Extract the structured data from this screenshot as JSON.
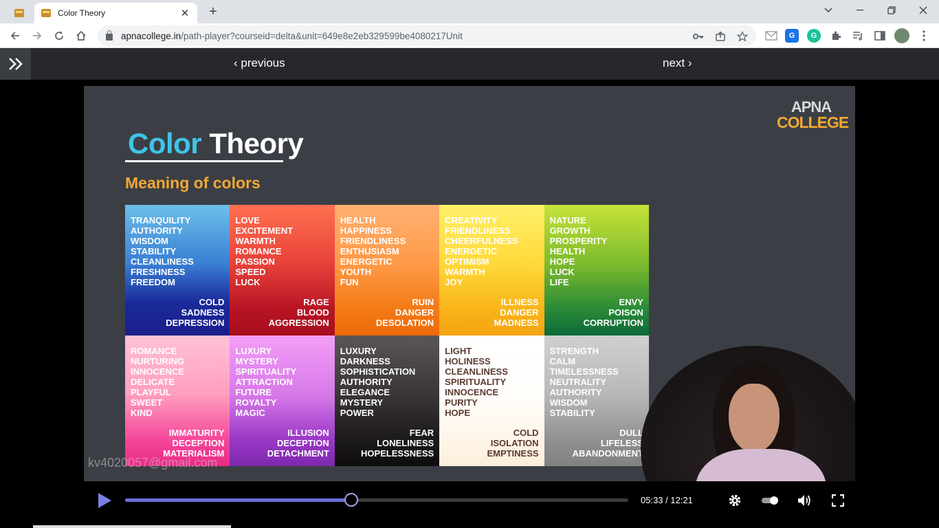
{
  "browser": {
    "tab_title": "Color Theory",
    "url_host": "apnacollege.in",
    "url_path": "/path-player?courseid=delta&unit=649e8e2eb329599be4080217Unit"
  },
  "player_nav": {
    "previous_label": "‹ previous",
    "next_label": "next ›"
  },
  "slide": {
    "title_part1": "Color",
    "title_part2": "Theory",
    "subtitle": "Meaning of colors",
    "logo_line1": "APNA",
    "logo_line2": "COLLEGE",
    "watermark": "kv4020057@gmail.com",
    "colors": [
      {
        "name": "blue",
        "positive": [
          "TRANQUILITY",
          "AUTHORITY",
          "WISDOM",
          "STABILITY",
          "CLEANLINESS",
          "FRESHNESS",
          "FREEDOM"
        ],
        "negative": [
          "COLD",
          "SADNESS",
          "DEPRESSION"
        ]
      },
      {
        "name": "red",
        "positive": [
          "LOVE",
          "EXCITEMENT",
          "WARMTH",
          "ROMANCE",
          "PASSION",
          "SPEED",
          "LUCK"
        ],
        "negative": [
          "RAGE",
          "BLOOD",
          "AGGRESSION"
        ]
      },
      {
        "name": "orange",
        "positive": [
          "HEALTH",
          "HAPPINESS",
          "FRIENDLINESS",
          "ENTHUSIASM",
          "ENERGETIC",
          "YOUTH",
          "FUN"
        ],
        "negative": [
          "RUIN",
          "DANGER",
          "DESOLATION"
        ]
      },
      {
        "name": "yellow",
        "positive": [
          "CREATIVITY",
          "FRIENDLINESS",
          "CHEERFULNESS",
          "ENERGETIC",
          "OPTIMISM",
          "WARMTH",
          "JOY"
        ],
        "negative": [
          "ILLNESS",
          "DANGER",
          "MADNESS"
        ]
      },
      {
        "name": "green",
        "positive": [
          "NATURE",
          "GROWTH",
          "PROSPERITY",
          "HEALTH",
          "HOPE",
          "LUCK",
          "LIFE"
        ],
        "negative": [
          "ENVY",
          "POISON",
          "CORRUPTION"
        ]
      },
      {
        "name": "pink",
        "positive": [
          "ROMANCE",
          "NURTURING",
          "INNOCENCE",
          "DELICATE",
          "PLAYFUL",
          "SWEET",
          "KIND"
        ],
        "negative": [
          "IMMATURITY",
          "DECEPTION",
          "MATERIALISM"
        ]
      },
      {
        "name": "purple",
        "positive": [
          "LUXURY",
          "MYSTERY",
          "SPIRITUALITY",
          "ATTRACTION",
          "FUTURE",
          "ROYALTY",
          "MAGIC"
        ],
        "negative": [
          "ILLUSION",
          "DECEPTION",
          "DETACHMENT"
        ]
      },
      {
        "name": "black",
        "positive": [
          "LUXURY",
          "DARKNESS",
          "SOPHISTICATION",
          "AUTHORITY",
          "ELEGANCE",
          "MYSTERY",
          "POWER"
        ],
        "negative": [
          "FEAR",
          "LONELINESS",
          "HOPELESSNESS"
        ]
      },
      {
        "name": "white",
        "positive": [
          "LIGHT",
          "HOLINESS",
          "CLEANLINESS",
          "SPIRITUALITY",
          "INNOCENCE",
          "PURITY",
          "HOPE"
        ],
        "negative": [
          "COLD",
          "ISOLATION",
          "EMPTINESS"
        ]
      },
      {
        "name": "gray",
        "positive": [
          "STRENGTH",
          "CALM",
          "TIMELESSNESS",
          "NEUTRALITY",
          "AUTHORITY",
          "WISDOM",
          "STABILITY"
        ],
        "negative": [
          "DULL",
          "LIFELESS",
          "ABANDONMENT"
        ]
      }
    ]
  },
  "controls": {
    "time_display": "05:33 / 12:21",
    "progress_fraction": 0.449,
    "accent_color": "#6b6fd6"
  }
}
